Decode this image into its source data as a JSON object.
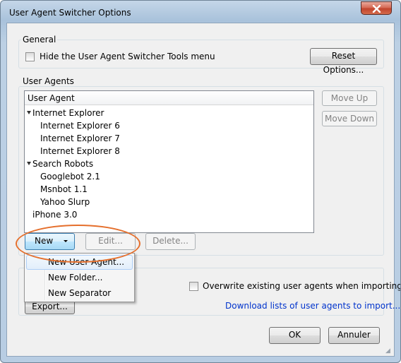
{
  "window": {
    "title": "User Agent Switcher Options"
  },
  "general": {
    "group_label": "General",
    "hide_menu_label": "Hide the User Agent Switcher Tools menu",
    "hide_menu_checked": false,
    "reset_button": "Reset Options..."
  },
  "user_agents": {
    "group_label": "User Agents",
    "column_header": "User Agent",
    "tree": [
      {
        "label": "Internet Explorer",
        "folder": true
      },
      {
        "label": "Internet Explorer 6",
        "folder": false
      },
      {
        "label": "Internet Explorer 7",
        "folder": false
      },
      {
        "label": "Internet Explorer 8",
        "folder": false
      },
      {
        "label": "Search Robots",
        "folder": true
      },
      {
        "label": "Googlebot 2.1",
        "folder": false
      },
      {
        "label": "Msnbot 1.1",
        "folder": false
      },
      {
        "label": "Yahoo Slurp",
        "folder": false
      },
      {
        "label": "iPhone 3.0",
        "folder": false
      }
    ],
    "move_up": "Move Up",
    "move_down": "Move Down",
    "new_button": "New",
    "edit_button": "Edit...",
    "delete_button": "Delete..."
  },
  "new_menu": {
    "items": [
      "New User Agent...",
      "New Folder...",
      "New Separator"
    ]
  },
  "import_export": {
    "overwrite_label": "Overwrite existing user agents when importing",
    "overwrite_checked": false,
    "export_button": "Export...",
    "download_link": "Download lists of user agents to import..."
  },
  "footer": {
    "ok": "OK",
    "cancel": "Annuler"
  },
  "colors": {
    "annotation": "#e56f2c",
    "link": "#0033cc"
  }
}
